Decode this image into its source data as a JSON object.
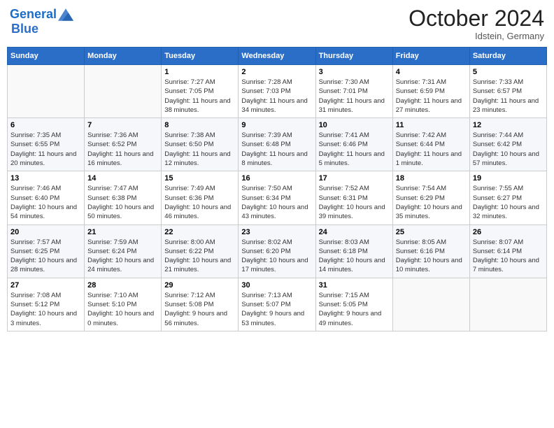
{
  "header": {
    "logo_line1": "General",
    "logo_line2": "Blue",
    "month": "October 2024",
    "location": "Idstein, Germany"
  },
  "weekdays": [
    "Sunday",
    "Monday",
    "Tuesday",
    "Wednesday",
    "Thursday",
    "Friday",
    "Saturday"
  ],
  "weeks": [
    [
      {
        "day": "",
        "info": ""
      },
      {
        "day": "",
        "info": ""
      },
      {
        "day": "1",
        "info": "Sunrise: 7:27 AM\nSunset: 7:05 PM\nDaylight: 11 hours and 38 minutes."
      },
      {
        "day": "2",
        "info": "Sunrise: 7:28 AM\nSunset: 7:03 PM\nDaylight: 11 hours and 34 minutes."
      },
      {
        "day": "3",
        "info": "Sunrise: 7:30 AM\nSunset: 7:01 PM\nDaylight: 11 hours and 31 minutes."
      },
      {
        "day": "4",
        "info": "Sunrise: 7:31 AM\nSunset: 6:59 PM\nDaylight: 11 hours and 27 minutes."
      },
      {
        "day": "5",
        "info": "Sunrise: 7:33 AM\nSunset: 6:57 PM\nDaylight: 11 hours and 23 minutes."
      }
    ],
    [
      {
        "day": "6",
        "info": "Sunrise: 7:35 AM\nSunset: 6:55 PM\nDaylight: 11 hours and 20 minutes."
      },
      {
        "day": "7",
        "info": "Sunrise: 7:36 AM\nSunset: 6:52 PM\nDaylight: 11 hours and 16 minutes."
      },
      {
        "day": "8",
        "info": "Sunrise: 7:38 AM\nSunset: 6:50 PM\nDaylight: 11 hours and 12 minutes."
      },
      {
        "day": "9",
        "info": "Sunrise: 7:39 AM\nSunset: 6:48 PM\nDaylight: 11 hours and 8 minutes."
      },
      {
        "day": "10",
        "info": "Sunrise: 7:41 AM\nSunset: 6:46 PM\nDaylight: 11 hours and 5 minutes."
      },
      {
        "day": "11",
        "info": "Sunrise: 7:42 AM\nSunset: 6:44 PM\nDaylight: 11 hours and 1 minute."
      },
      {
        "day": "12",
        "info": "Sunrise: 7:44 AM\nSunset: 6:42 PM\nDaylight: 10 hours and 57 minutes."
      }
    ],
    [
      {
        "day": "13",
        "info": "Sunrise: 7:46 AM\nSunset: 6:40 PM\nDaylight: 10 hours and 54 minutes."
      },
      {
        "day": "14",
        "info": "Sunrise: 7:47 AM\nSunset: 6:38 PM\nDaylight: 10 hours and 50 minutes."
      },
      {
        "day": "15",
        "info": "Sunrise: 7:49 AM\nSunset: 6:36 PM\nDaylight: 10 hours and 46 minutes."
      },
      {
        "day": "16",
        "info": "Sunrise: 7:50 AM\nSunset: 6:34 PM\nDaylight: 10 hours and 43 minutes."
      },
      {
        "day": "17",
        "info": "Sunrise: 7:52 AM\nSunset: 6:31 PM\nDaylight: 10 hours and 39 minutes."
      },
      {
        "day": "18",
        "info": "Sunrise: 7:54 AM\nSunset: 6:29 PM\nDaylight: 10 hours and 35 minutes."
      },
      {
        "day": "19",
        "info": "Sunrise: 7:55 AM\nSunset: 6:27 PM\nDaylight: 10 hours and 32 minutes."
      }
    ],
    [
      {
        "day": "20",
        "info": "Sunrise: 7:57 AM\nSunset: 6:25 PM\nDaylight: 10 hours and 28 minutes."
      },
      {
        "day": "21",
        "info": "Sunrise: 7:59 AM\nSunset: 6:24 PM\nDaylight: 10 hours and 24 minutes."
      },
      {
        "day": "22",
        "info": "Sunrise: 8:00 AM\nSunset: 6:22 PM\nDaylight: 10 hours and 21 minutes."
      },
      {
        "day": "23",
        "info": "Sunrise: 8:02 AM\nSunset: 6:20 PM\nDaylight: 10 hours and 17 minutes."
      },
      {
        "day": "24",
        "info": "Sunrise: 8:03 AM\nSunset: 6:18 PM\nDaylight: 10 hours and 14 minutes."
      },
      {
        "day": "25",
        "info": "Sunrise: 8:05 AM\nSunset: 6:16 PM\nDaylight: 10 hours and 10 minutes."
      },
      {
        "day": "26",
        "info": "Sunrise: 8:07 AM\nSunset: 6:14 PM\nDaylight: 10 hours and 7 minutes."
      }
    ],
    [
      {
        "day": "27",
        "info": "Sunrise: 7:08 AM\nSunset: 5:12 PM\nDaylight: 10 hours and 3 minutes."
      },
      {
        "day": "28",
        "info": "Sunrise: 7:10 AM\nSunset: 5:10 PM\nDaylight: 10 hours and 0 minutes."
      },
      {
        "day": "29",
        "info": "Sunrise: 7:12 AM\nSunset: 5:08 PM\nDaylight: 9 hours and 56 minutes."
      },
      {
        "day": "30",
        "info": "Sunrise: 7:13 AM\nSunset: 5:07 PM\nDaylight: 9 hours and 53 minutes."
      },
      {
        "day": "31",
        "info": "Sunrise: 7:15 AM\nSunset: 5:05 PM\nDaylight: 9 hours and 49 minutes."
      },
      {
        "day": "",
        "info": ""
      },
      {
        "day": "",
        "info": ""
      }
    ]
  ]
}
